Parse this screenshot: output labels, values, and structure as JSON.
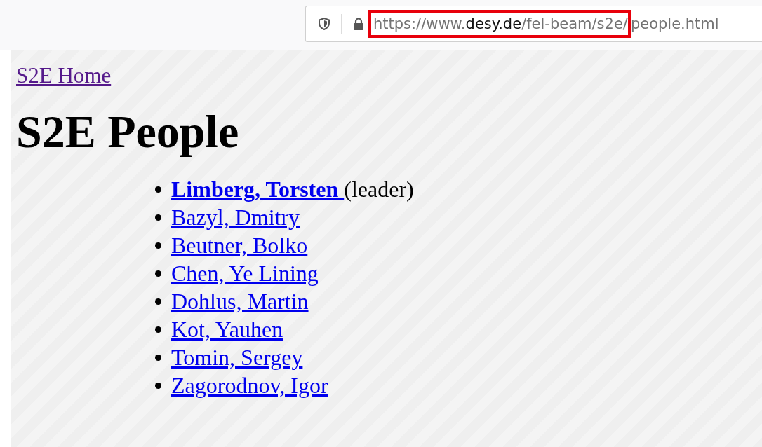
{
  "toolbar": {
    "url": {
      "highlighted": "https://www.**desy.de**/fel-beam/s2e/",
      "rest": "people.html"
    }
  },
  "page": {
    "home_link": {
      "text": "S2E Home",
      "visited": true
    },
    "heading": "S2E People",
    "people": [
      {
        "name": "Limberg, Torsten ",
        "bold": true,
        "note": "(leader)"
      },
      {
        "name": "Bazyl, Dmitry",
        "bold": false
      },
      {
        "name": "Beutner, Bolko",
        "bold": false
      },
      {
        "name": "Chen, Ye Lining",
        "bold": false
      },
      {
        "name": "Dohlus, Martin",
        "bold": false
      },
      {
        "name": "Kot, Yauhen",
        "bold": false
      },
      {
        "name": "Tomin, Sergey",
        "bold": false
      },
      {
        "name": "Zagorodnov, Igor",
        "bold": false
      }
    ]
  }
}
